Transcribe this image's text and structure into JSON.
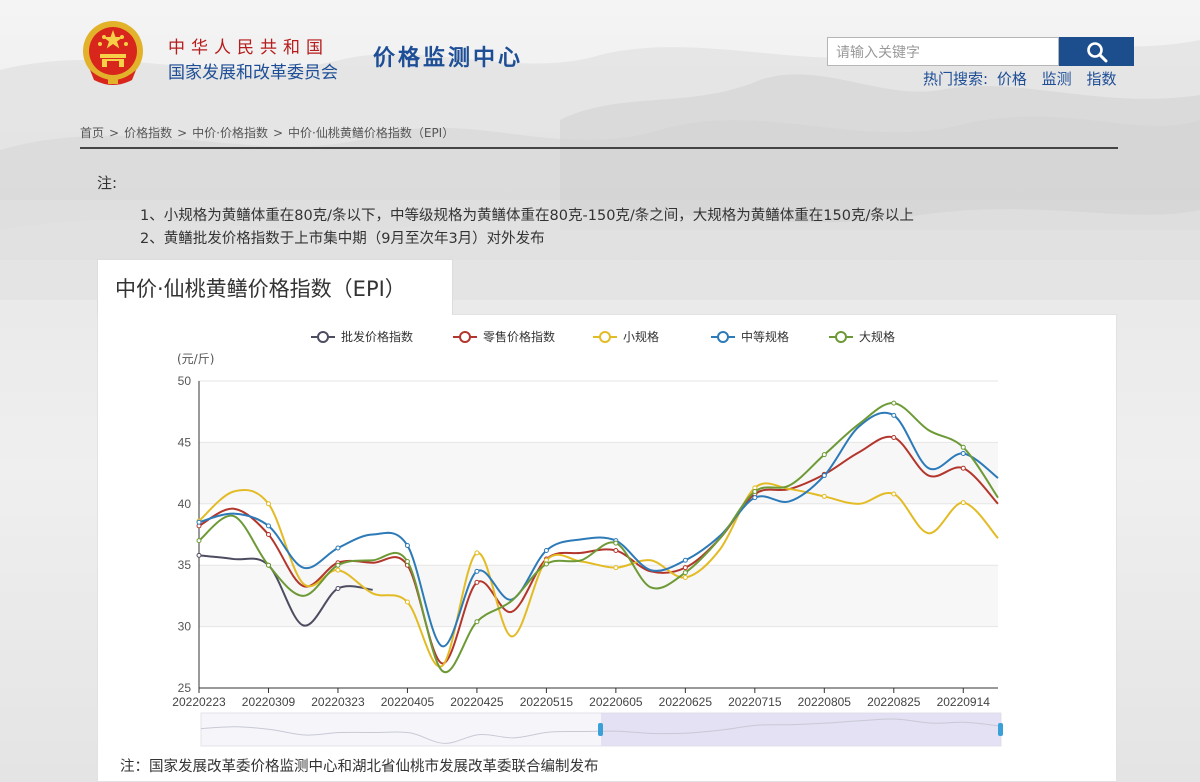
{
  "header": {
    "country": "中华人民共和国",
    "org": "国家发展和改革委员会",
    "center": "价格监测中心",
    "search_placeholder": "请输入关键字",
    "hot_label": "热门搜索:",
    "hot_items": [
      "价格",
      "监测",
      "指数"
    ]
  },
  "breadcrumb": [
    "首页",
    "价格指数",
    "中价·价格指数",
    "中价·仙桃黄鳝价格指数（EPI）"
  ],
  "breadcrumb_sep": ">",
  "notes": {
    "label": "注:",
    "items": [
      "1、小规格为黄鳝体重在80克/条以下，中等级规格为黄鳝体重在80克-150克/条之间，大规格为黄鳝体重在150克/条以上",
      "2、黄鳝批发价格指数于上市集中期（9月至次年3月）对外发布"
    ]
  },
  "tab_title": "中价·仙桃黄鳝价格指数（EPI）",
  "footer_note": "注：国家发展改革委价格监测中心和湖北省仙桃市发展改革委联合编制发布",
  "chart_data": {
    "type": "line",
    "ylabel": "(元/斤)",
    "ylim": [
      25,
      50
    ],
    "yticks": [
      25,
      30,
      35,
      40,
      45,
      50
    ],
    "xticks": [
      "20220223",
      "20220309",
      "20220323",
      "20220405",
      "20220425",
      "20220515",
      "20220605",
      "20220625",
      "20220715",
      "20220805",
      "20220825",
      "20220914"
    ],
    "x": [
      "20220223",
      "20220302",
      "20220309",
      "20220316",
      "20220323",
      "20220330",
      "20220405",
      "20220415",
      "20220425",
      "20220505",
      "20220515",
      "20220525",
      "20220605",
      "20220615",
      "20220625",
      "20220705",
      "20220715",
      "20220725",
      "20220805",
      "20220815",
      "20220825",
      "20220905",
      "20220914",
      "20220924"
    ],
    "legend_position": "top-center",
    "grid": "horizontal-bands",
    "series": [
      {
        "name": "批发价格指数",
        "color": "#4d4d62",
        "values": [
          35.8,
          35.5,
          35.0,
          30.1,
          33.1,
          33.0,
          null,
          null,
          null,
          null,
          null,
          null,
          null,
          null,
          null,
          null,
          null,
          null,
          null,
          null,
          null,
          null,
          null,
          null
        ]
      },
      {
        "name": "零售价格指数",
        "color": "#b3362c",
        "values": [
          38.2,
          39.6,
          37.5,
          33.3,
          35.2,
          35.2,
          35.0,
          27.0,
          33.6,
          31.2,
          35.5,
          36.0,
          36.2,
          34.5,
          34.8,
          37.2,
          40.8,
          41.2,
          42.4,
          44.2,
          45.4,
          42.3,
          42.9,
          40.0
        ]
      },
      {
        "name": "小规格",
        "color": "#e3bb25",
        "values": [
          38.6,
          41.0,
          40.0,
          33.5,
          34.6,
          32.7,
          32.0,
          26.8,
          36.0,
          29.2,
          35.4,
          35.3,
          34.8,
          35.4,
          34.0,
          36.3,
          41.3,
          41.2,
          40.6,
          40.0,
          40.8,
          37.6,
          40.1,
          37.2
        ]
      },
      {
        "name": "中等规格",
        "color": "#2c7ab8",
        "values": [
          38.5,
          39.2,
          38.2,
          34.8,
          36.4,
          37.5,
          36.6,
          28.4,
          34.5,
          32.2,
          36.2,
          37.1,
          37.0,
          34.6,
          35.4,
          37.4,
          40.5,
          40.2,
          42.3,
          46.3,
          47.2,
          42.9,
          44.1,
          42.1
        ]
      },
      {
        "name": "大规格",
        "color": "#6d9a36",
        "values": [
          37.0,
          39.0,
          35.0,
          32.5,
          35.0,
          35.4,
          35.3,
          26.4,
          30.4,
          32.1,
          35.1,
          35.4,
          36.8,
          33.2,
          34.4,
          37.2,
          41.0,
          41.5,
          44.0,
          46.5,
          48.2,
          46.0,
          44.6,
          40.5
        ]
      }
    ]
  }
}
